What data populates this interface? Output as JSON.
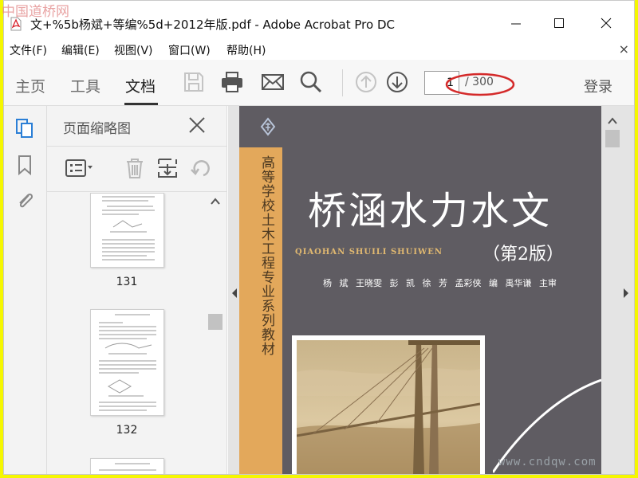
{
  "window": {
    "title": "文+%5b杨斌+等编%5d+2012年版.pdf - Adobe Acrobat Pro DC"
  },
  "menu": {
    "items": [
      "文件(F)",
      "编辑(E)",
      "视图(V)",
      "窗口(W)",
      "帮助(H)"
    ],
    "close": "×"
  },
  "toolbar": {
    "tabs": [
      "主页",
      "工具",
      "文档"
    ],
    "active_tab": "文档",
    "page_current": "1",
    "page_total": "/ 300",
    "login": "登录"
  },
  "thumbnails": {
    "panel_title": "页面缩略图",
    "pages": [
      "131",
      "132"
    ]
  },
  "document": {
    "spine_text": "高等学校土木工程专业系列教材",
    "title": "桥涵水力水文",
    "pinyin": "QIAOHAN SHUILI SHUIWEN",
    "edition": "（第2版）",
    "authors": "杨 斌  王晓雯  彭 凯  徐 芳  孟彩侠  编    禹华谦  主审"
  },
  "watermarks": {
    "top": "中国道桥网",
    "bottom": "www.cndqw.com"
  },
  "colors": {
    "highlight_ellipse": "#d42a2a",
    "acrobat_red": "#d8202a",
    "sidebar_active": "#2b7fd6",
    "spine": "#e3a85b",
    "cover": "#5f5c62"
  }
}
